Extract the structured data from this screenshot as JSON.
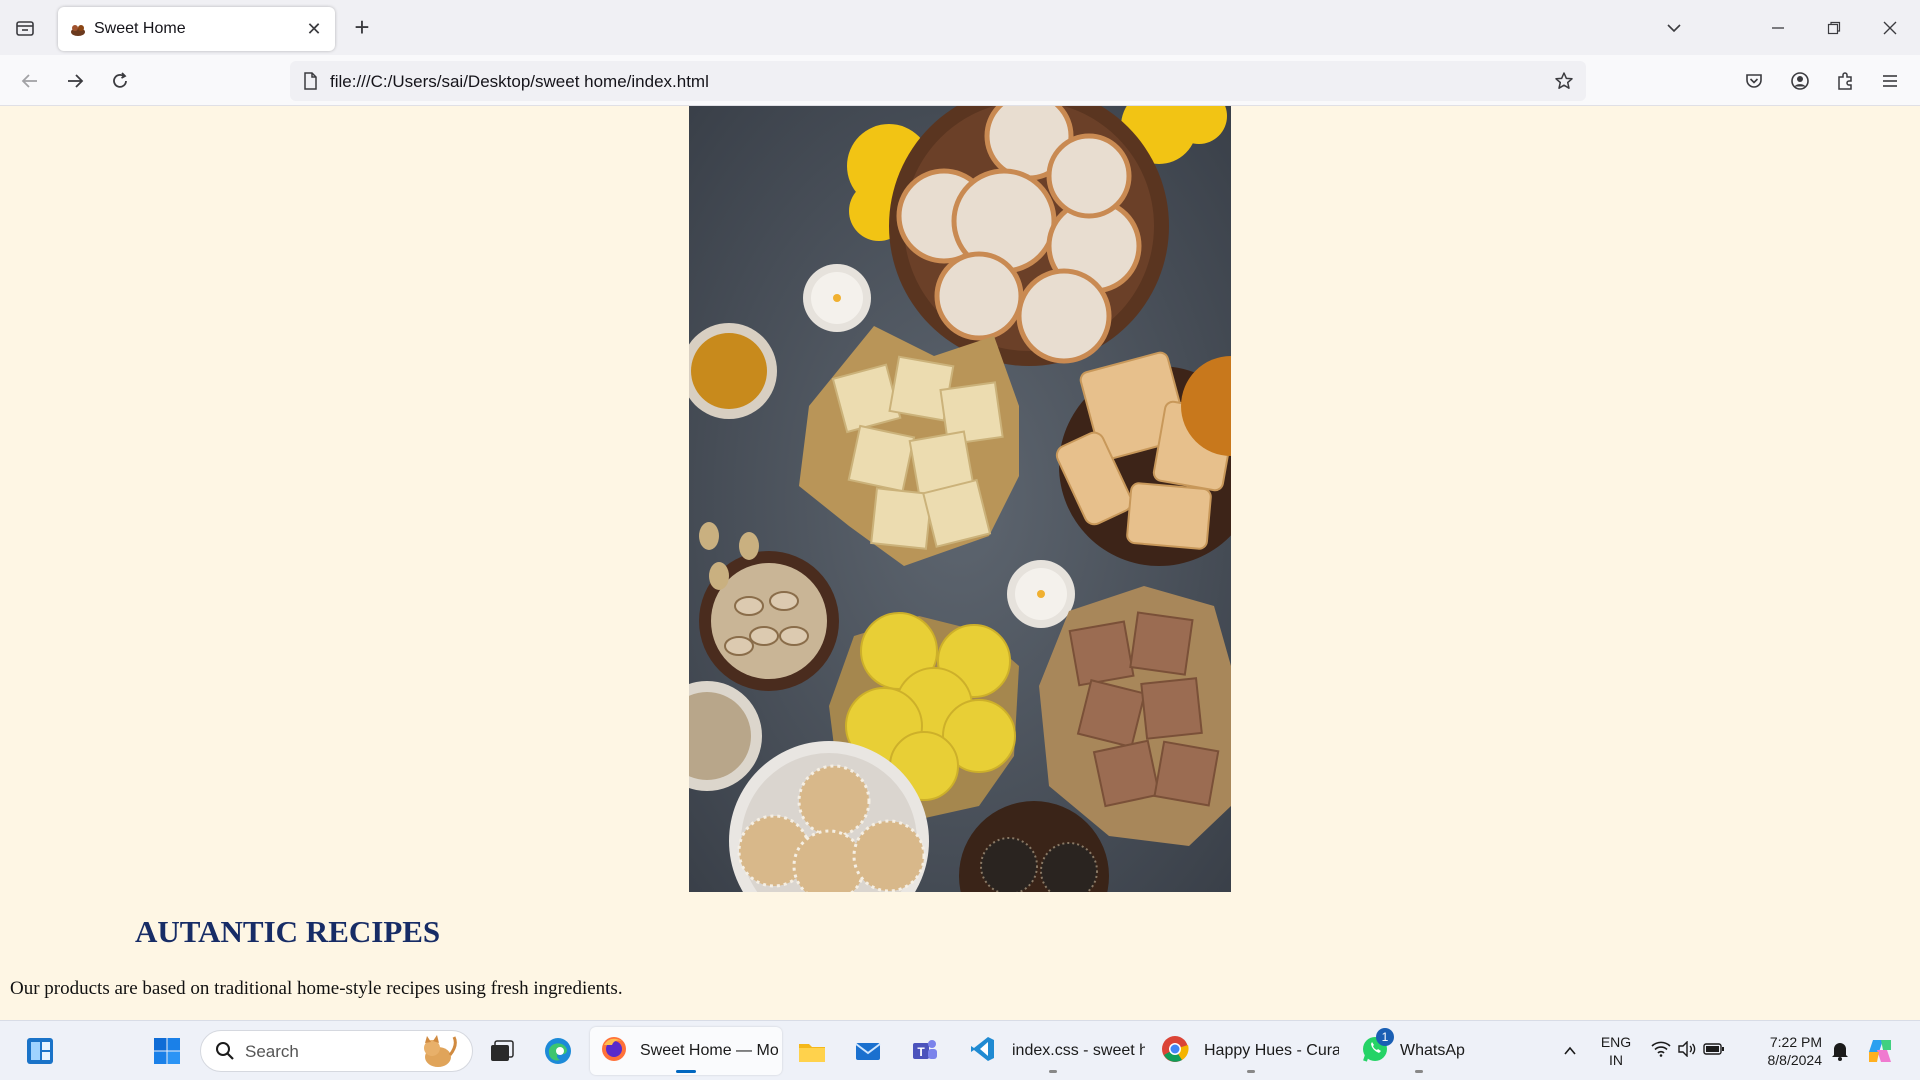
{
  "browser": {
    "tab_title": "Sweet Home",
    "url": "file:///C:/Users/sai/Desktop/sweet home/index.html"
  },
  "page": {
    "heading": "AUTANTIC RECIPES",
    "paragraph": "Our products are based on traditional home-style recipes using fresh ingredients.",
    "hero_image": "sweets-platter-image",
    "background_color": "#fef6e4",
    "heading_color": "#172c66"
  },
  "taskbar": {
    "search_placeholder": "Search",
    "apps": [
      {
        "name": "firefox",
        "label": "Sweet Home — Mo:"
      },
      {
        "name": "vscode",
        "label": "index.css - sweet ho"
      },
      {
        "name": "chrome",
        "label": "Happy Hues - Curat"
      },
      {
        "name": "whatsapp",
        "label": "WhatsAp|",
        "badge": "1"
      }
    ],
    "language_top": "ENG",
    "language_bottom": "IN",
    "time": "7:22 PM",
    "date": "8/8/2024"
  }
}
